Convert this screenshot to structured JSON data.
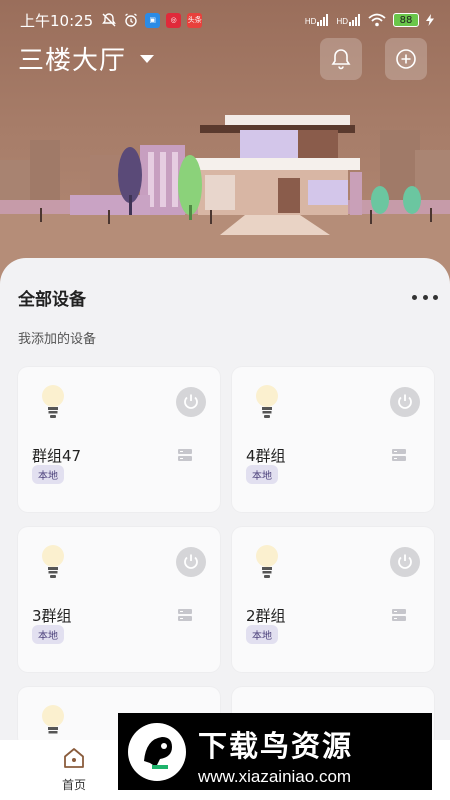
{
  "status_bar": {
    "time": "上午10:25",
    "battery": "88",
    "left_badges": [
      {
        "icon": "bilibili-icon",
        "color": "#2b8be6"
      },
      {
        "icon": "target-app-icon",
        "color": "#e02a3a"
      },
      {
        "icon": "toutiao-icon",
        "color": "#e8413c",
        "label": "头条"
      }
    ],
    "network": [
      "HD",
      "HD"
    ]
  },
  "header": {
    "home_name": "三楼大厅",
    "bell_icon": "bell-icon",
    "add_icon": "plus-circle-icon",
    "bg_color": "#a77d69"
  },
  "section": {
    "title": "全部设备",
    "subtitle": "我添加的设备"
  },
  "devices": [
    {
      "name": "群组47",
      "tag": "本地",
      "icon": "bulb-icon"
    },
    {
      "name": "4群组",
      "tag": "本地",
      "icon": "bulb-icon"
    },
    {
      "name": "3群组",
      "tag": "本地",
      "icon": "bulb-icon"
    },
    {
      "name": "2群组",
      "tag": "本地",
      "icon": "bulb-icon"
    },
    {
      "name": "",
      "tag": "",
      "icon": "bulb-icon"
    },
    {
      "name": "",
      "tag": "",
      "icon": "bulb-icon"
    }
  ],
  "bottom_nav": {
    "home_label": "首页",
    "home_icon": "home-icon"
  },
  "watermark": {
    "title": "下载鸟资源",
    "url": "www.xiazainiao.com"
  }
}
